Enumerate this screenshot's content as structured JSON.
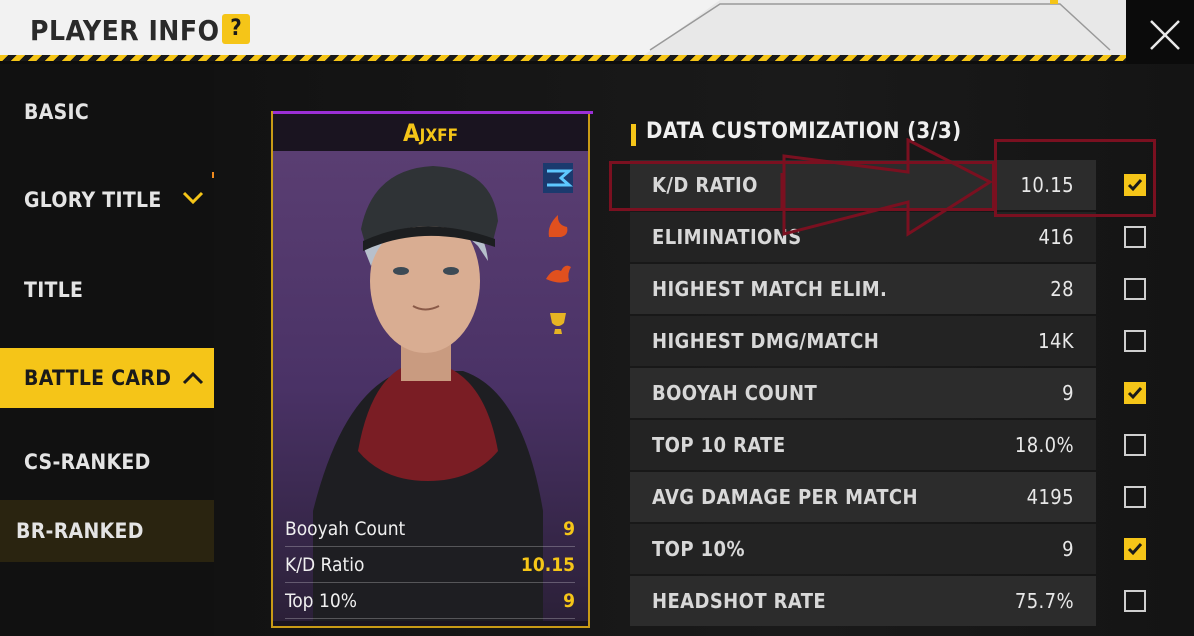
{
  "header": {
    "title": "PLAYER INFO",
    "help": "?"
  },
  "sidebar": {
    "items": [
      {
        "label": "BASIC"
      },
      {
        "label": "GLORY TITLE",
        "chevron": "chevron-down"
      },
      {
        "label": "TITLE"
      },
      {
        "label": "BATTLE CARD",
        "chevron": "chevron-up"
      },
      {
        "label": "CS-RANKED"
      },
      {
        "label": "BR-RANKED"
      }
    ]
  },
  "card": {
    "player_name": "Ajxff",
    "stats": [
      {
        "label": "Booyah Count",
        "value": "9"
      },
      {
        "label": "K/D Ratio",
        "value": "10.15"
      },
      {
        "label": "Top 10%",
        "value": "9"
      }
    ]
  },
  "customization": {
    "title": "DATA CUSTOMIZATION (3/3)",
    "rows": [
      {
        "label": "K/D RATIO",
        "value": "10.15",
        "checked": true
      },
      {
        "label": "ELIMINATIONS",
        "value": "416",
        "checked": false
      },
      {
        "label": "HIGHEST MATCH ELIM.",
        "value": "28",
        "checked": false
      },
      {
        "label": "HIGHEST DMG/MATCH",
        "value": "14K",
        "checked": false
      },
      {
        "label": "BOOYAH COUNT",
        "value": "9",
        "checked": true
      },
      {
        "label": "TOP 10 RATE",
        "value": "18.0%",
        "checked": false
      },
      {
        "label": "AVG DAMAGE PER MATCH",
        "value": "4195",
        "checked": false
      },
      {
        "label": "TOP 10%",
        "value": "9",
        "checked": true
      },
      {
        "label": "HEADSHOT RATE",
        "value": "75.7%",
        "checked": false
      }
    ]
  },
  "colors": {
    "accent": "#f5c518",
    "annotation": "#7a1020"
  }
}
